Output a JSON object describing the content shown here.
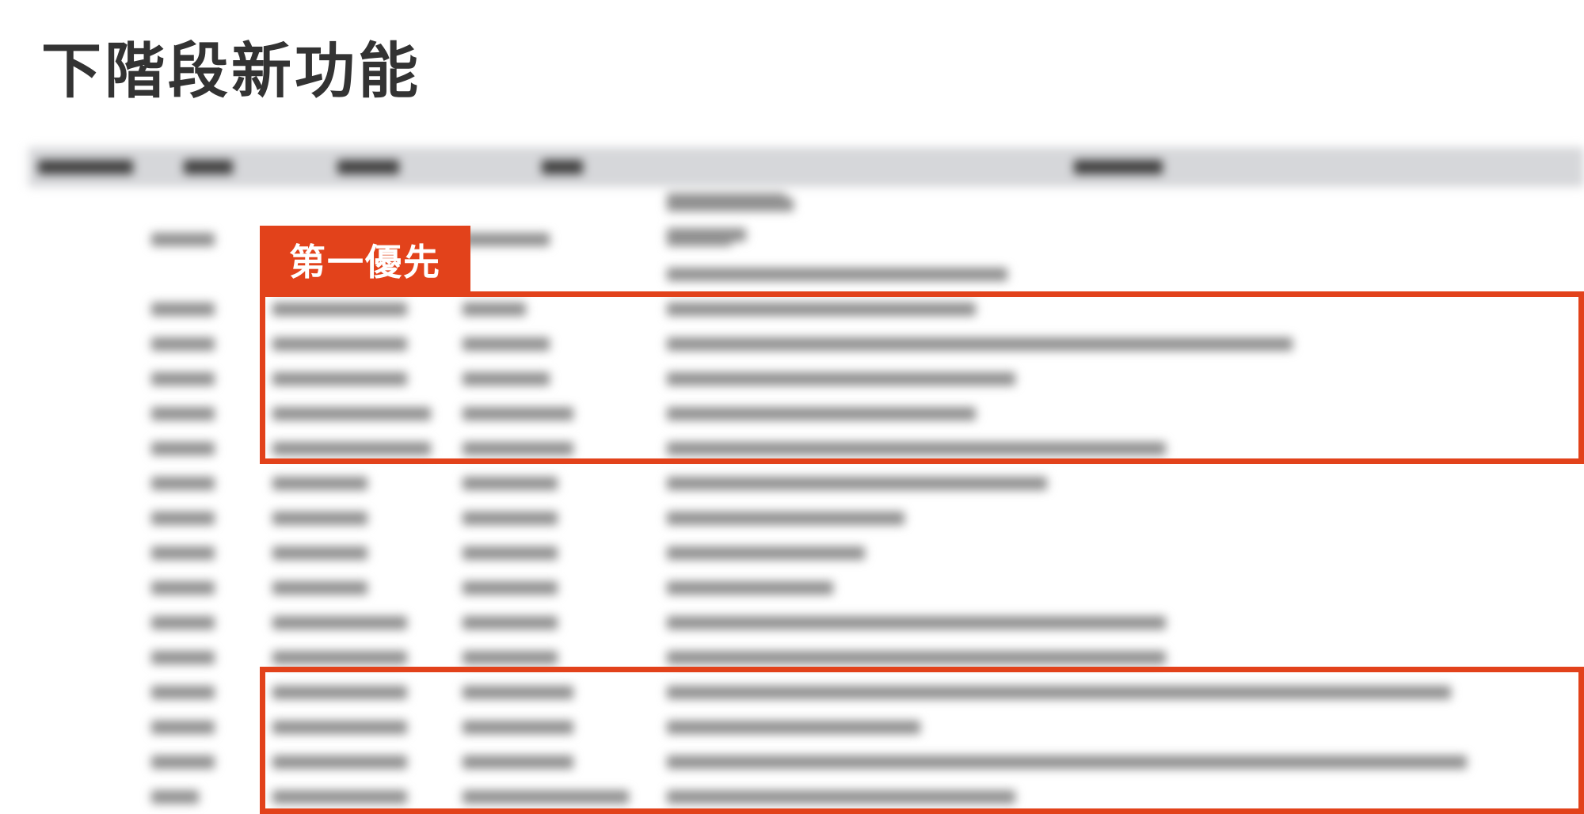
{
  "slide": {
    "title": "下階段新功能",
    "priority_label": "第一優先"
  },
  "colors": {
    "accent": "#e2421b",
    "title_text": "#333333",
    "table_header_bg": "#d6d7da"
  },
  "table": {
    "note": "",
    "columns": 5,
    "body_rows": 18
  }
}
